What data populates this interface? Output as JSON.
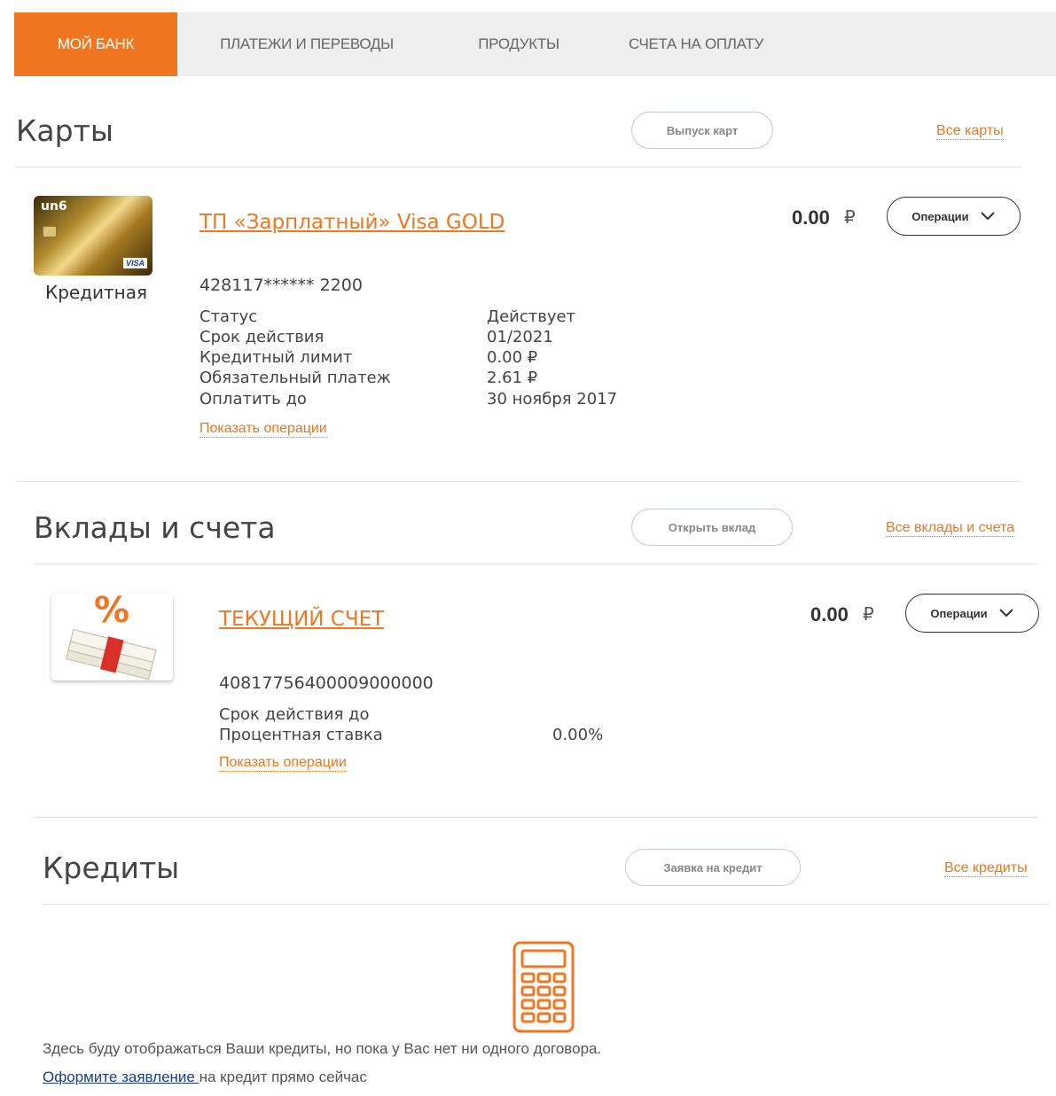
{
  "nav": {
    "tabs": [
      {
        "label": "МОЙ БАНК",
        "active": true
      },
      {
        "label": "ПЛАТЕЖИ И ПЕРЕВОДЫ",
        "active": false
      },
      {
        "label": "ПРОДУКТЫ",
        "active": false
      },
      {
        "label": "СЧЕТА НА ОПЛАТУ",
        "active": false
      }
    ]
  },
  "colors": {
    "accent": "#f07621",
    "link_blue": "#1a3d8f"
  },
  "cards": {
    "title": "Карты",
    "issue_button": "Выпуск карт",
    "all_link": "Все карты",
    "item": {
      "card_logo": "un6",
      "card_brand": "VISA",
      "type": "Кредитная",
      "name": "ТП «Зарплатный» Visa GOLD",
      "number": "428117****** 2200",
      "amount": "0.00",
      "currency": "₽",
      "operations_button": "Операции",
      "details": [
        {
          "label": "Статус",
          "value": "Действует"
        },
        {
          "label": "Срок действия",
          "value": "01/2021"
        },
        {
          "label": "Кредитный лимит",
          "value": "0.00 ₽"
        },
        {
          "label": "Обязательный платеж",
          "value": "2.61 ₽"
        },
        {
          "label": "Оплатить до",
          "value": "30 ноября 2017"
        }
      ],
      "show_operations": "Показать операции"
    }
  },
  "deposits": {
    "title": "Вклады и счета",
    "open_button": "Открыть вклад",
    "all_link": "Все вклады и счета",
    "item": {
      "name": "ТЕКУЩИЙ СЧЕТ",
      "number": "40817756400009000000",
      "amount": "0.00",
      "currency": "₽",
      "operations_button": "Операции",
      "details": [
        {
          "label": "Срок действия до",
          "value": ""
        },
        {
          "label": "Процентная ставка",
          "value": "0.00%"
        }
      ],
      "show_operations": "Показать операции"
    }
  },
  "credits": {
    "title": "Кредиты",
    "apply_button": "Заявка на кредит",
    "all_link": "Все кредиты",
    "empty_text": "Здесь буду отображаться Ваши кредиты, но пока у Вас нет ни одного договора.",
    "apply_link": "Оформите заявление ",
    "apply_suffix": "на кредит прямо сейчас"
  }
}
